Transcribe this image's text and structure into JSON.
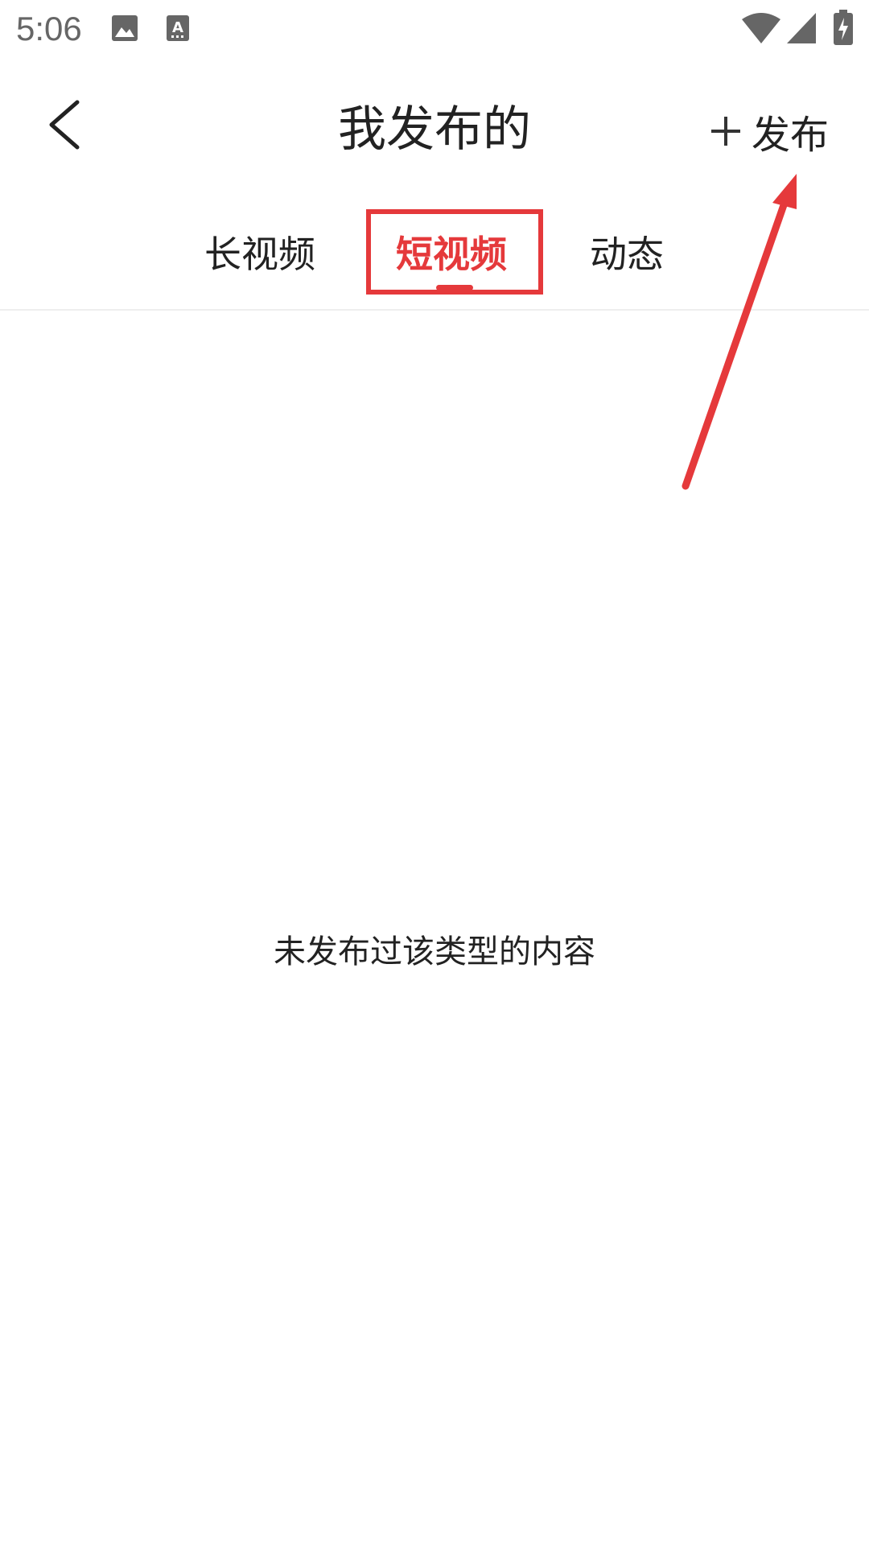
{
  "status_bar": {
    "time": "5:06",
    "icons": [
      "image-icon",
      "text-a-icon",
      "wifi-icon",
      "signal-icon",
      "battery-charging-icon"
    ]
  },
  "header": {
    "title": "我发布的",
    "back_icon": "chevron-left-icon",
    "publish_label": "发布",
    "publish_icon": "plus-icon"
  },
  "tabs": [
    {
      "label": "长视频",
      "active": false
    },
    {
      "label": "短视频",
      "active": true
    },
    {
      "label": "动态",
      "active": false
    }
  ],
  "empty_state": {
    "message": "未发布过该类型的内容"
  },
  "colors": {
    "accent": "#e5393b",
    "text": "#222222",
    "status": "#666666"
  }
}
